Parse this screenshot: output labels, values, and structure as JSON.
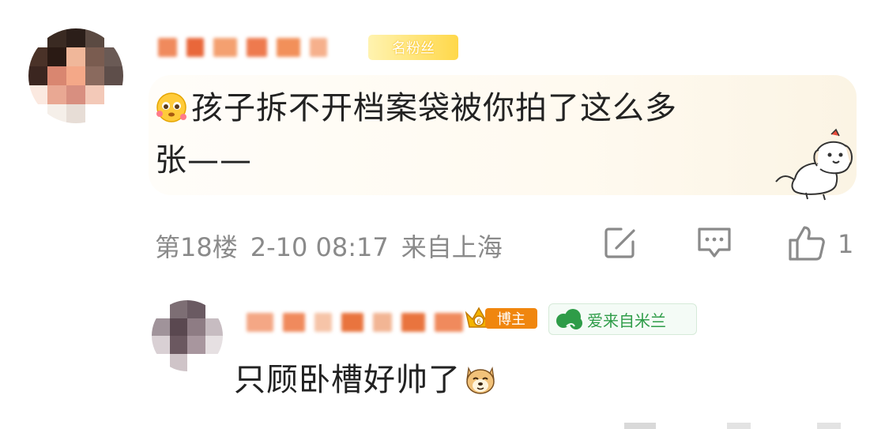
{
  "main_comment": {
    "author_name": "",
    "fans_badge": "名粉丝",
    "text_line1": "孩子拆不开档案袋被你拍了这么多",
    "text_line2": "张——",
    "floor": "第18楼",
    "datetime": "2-10 08:17",
    "location": "来自上海",
    "like_count": "1",
    "inline_emoji": "pleading-face-icon",
    "sticker": "dog-sticker"
  },
  "reply": {
    "author_name": "",
    "blogger_badge": "博主",
    "milan_badge": "爱来自米兰",
    "text": "只顾卧槽好帅了",
    "trailing_emoji": "doge-icon"
  },
  "icons": {
    "repost": "repost-icon",
    "comment": "comment-icon",
    "like": "thumbs-up-icon"
  },
  "colors": {
    "accent_orange": "#f0860e",
    "milan_green": "#2e9c48",
    "meta_gray": "#8a8a8a",
    "fans_yellow": "#ffd84a"
  }
}
